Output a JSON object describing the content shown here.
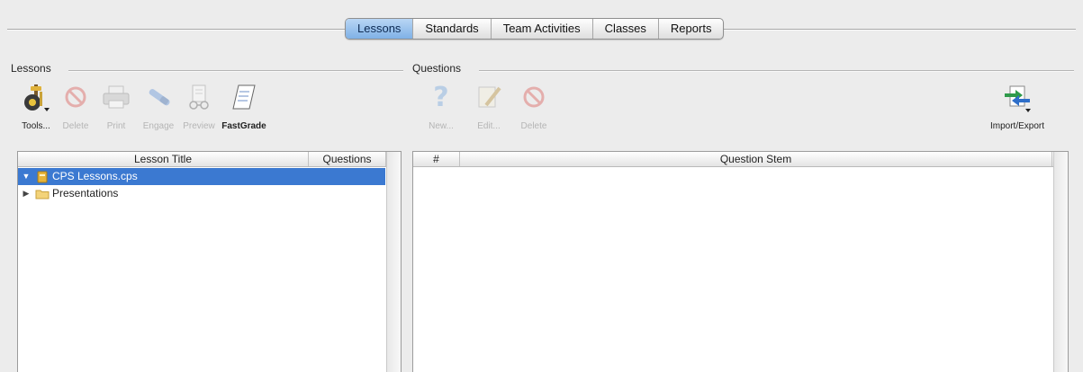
{
  "tabs": [
    {
      "label": "Lessons",
      "active": true
    },
    {
      "label": "Standards",
      "active": false
    },
    {
      "label": "Team Activities",
      "active": false
    },
    {
      "label": "Classes",
      "active": false
    },
    {
      "label": "Reports",
      "active": false
    }
  ],
  "lessons_panel": {
    "title": "Lessons",
    "toolbar": {
      "tools": "Tools...",
      "delete": "Delete",
      "print": "Print",
      "engage": "Engage",
      "preview": "Preview",
      "fastgrade": "FastGrade"
    },
    "columns": {
      "lesson_title": "Lesson Title",
      "questions": "Questions"
    },
    "tree": [
      {
        "label": "CPS Lessons.cps",
        "expanded": true,
        "selected": true
      },
      {
        "label": "Presentations",
        "expanded": false,
        "selected": false
      }
    ]
  },
  "questions_panel": {
    "title": "Questions",
    "toolbar": {
      "new": "New...",
      "edit": "Edit...",
      "delete": "Delete",
      "import_export": "Import/Export"
    },
    "columns": {
      "number": "#",
      "question_stem": "Question Stem"
    }
  },
  "colors": {
    "selection": "#3b79d1",
    "active_tab": "#8fbbe9",
    "delete_red": "#d9534f"
  }
}
